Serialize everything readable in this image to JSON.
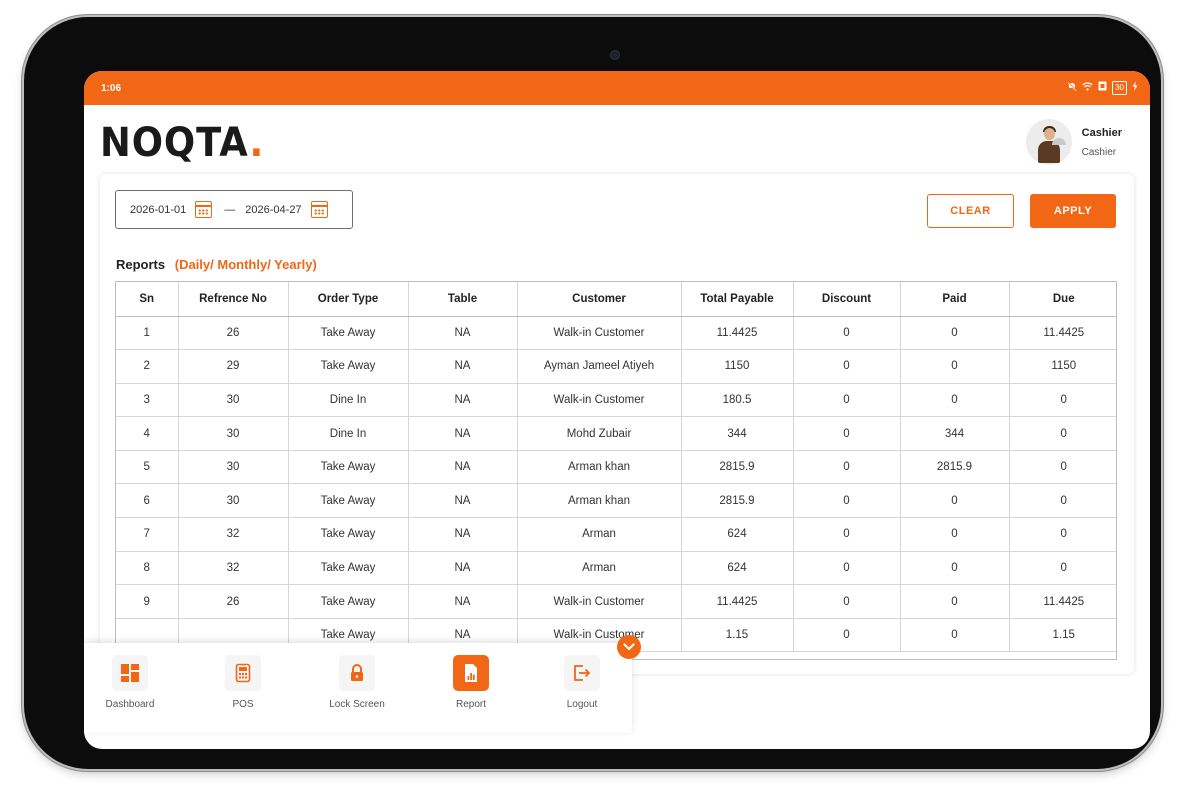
{
  "status_bar": {
    "time": "1:06",
    "icons": [
      "mute-icon",
      "wifi-icon",
      "sim-icon",
      "battery-icon",
      "charging-icon"
    ],
    "battery": "30"
  },
  "header": {
    "logo_text": "NOQ",
    "logo_text2": "TA",
    "logo_dot": ".",
    "user_name": "Cashier",
    "user_role": "Cashier"
  },
  "filters": {
    "start_date": "2026-01-01",
    "separator": "—",
    "end_date": "2026-04-27",
    "clear_label": "CLEAR",
    "apply_label": "APPLY"
  },
  "reports": {
    "title": "Reports",
    "subtitle": "(Daily/ Monthly/ Yearly)"
  },
  "table": {
    "columns": [
      "Sn",
      "Refrence No",
      "Order Type",
      "Table",
      "Customer",
      "Total Payable",
      "Discount",
      "Paid",
      "Due"
    ],
    "rows": [
      [
        "1",
        "26",
        "Take Away",
        "NA",
        "Walk-in Customer",
        "11.4425",
        "0",
        "0",
        "11.4425"
      ],
      [
        "2",
        "29",
        "Take Away",
        "NA",
        "Ayman Jameel Atiyeh",
        "1150",
        "0",
        "0",
        "1150"
      ],
      [
        "3",
        "30",
        "Dine In",
        "NA",
        "Walk-in Customer",
        "180.5",
        "0",
        "0",
        "0"
      ],
      [
        "4",
        "30",
        "Dine In",
        "NA",
        "Mohd Zubair",
        "344",
        "0",
        "344",
        "0"
      ],
      [
        "5",
        "30",
        "Take Away",
        "NA",
        "Arman khan",
        "2815.9",
        "0",
        "2815.9",
        "0"
      ],
      [
        "6",
        "30",
        "Take Away",
        "NA",
        "Arman khan",
        "2815.9",
        "0",
        "0",
        "0"
      ],
      [
        "7",
        "32",
        "Take Away",
        "NA",
        "Arman",
        "624",
        "0",
        "0",
        "0"
      ],
      [
        "8",
        "32",
        "Take Away",
        "NA",
        "Arman",
        "624",
        "0",
        "0",
        "0"
      ],
      [
        "9",
        "26",
        "Take Away",
        "NA",
        "Walk-in Customer",
        "11.4425",
        "0",
        "0",
        "11.4425"
      ],
      [
        "",
        "",
        "Take Away",
        "NA",
        "Walk-in Customer",
        "1.15",
        "0",
        "0",
        "1.15"
      ]
    ]
  },
  "nav": {
    "items": [
      {
        "label": "Dashboard",
        "icon": "dashboard-icon"
      },
      {
        "label": "POS",
        "icon": "pos-icon"
      },
      {
        "label": "Lock Screen",
        "icon": "lock-icon"
      },
      {
        "label": "Report",
        "icon": "report-icon",
        "active": true
      },
      {
        "label": "Logout",
        "icon": "logout-icon"
      }
    ]
  },
  "colors": {
    "accent": "#f26716",
    "text": "#333333",
    "border": "#bdbdbd"
  }
}
